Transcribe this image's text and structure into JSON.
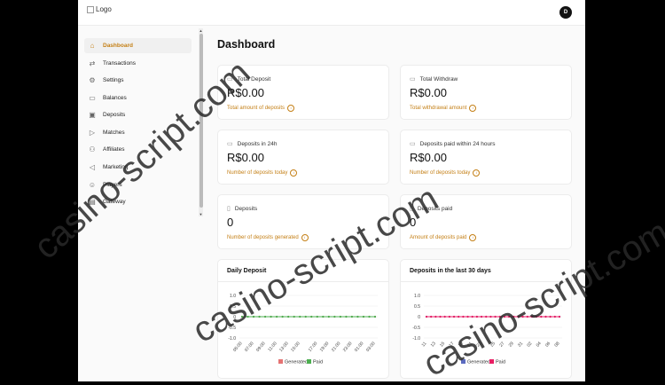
{
  "header": {
    "logo_alt": "Logo",
    "avatar_initial": "D"
  },
  "sidebar": {
    "items": [
      {
        "label": "Dashboard",
        "icon": "home-icon",
        "active": true
      },
      {
        "label": "Transactions",
        "icon": "transfer-icon"
      },
      {
        "label": "Settings",
        "icon": "gear-icon"
      },
      {
        "label": "Balances",
        "icon": "wallet-icon"
      },
      {
        "label": "Deposits",
        "icon": "box-icon"
      },
      {
        "label": "Matches",
        "icon": "play-icon"
      },
      {
        "label": "Affiliates",
        "icon": "users-icon"
      },
      {
        "label": "Marketing",
        "icon": "megaphone-icon"
      },
      {
        "label": "Players",
        "icon": "players-icon"
      },
      {
        "label": "Gateway",
        "icon": "gateway-icon"
      }
    ]
  },
  "page": {
    "title": "Dashboard"
  },
  "cards": [
    {
      "label": "Total Deposit",
      "value": "R$0.00",
      "sub": "Total amount of deposits"
    },
    {
      "label": "Total Withdraw",
      "value": "R$0.00",
      "sub": "Total withdrawal amount"
    },
    {
      "label": "Deposits in 24h",
      "value": "R$0.00",
      "sub": "Number of deposits today"
    },
    {
      "label": "Deposits paid within 24 hours",
      "value": "R$0.00",
      "sub": "Number of deposits today"
    },
    {
      "label": "Deposits",
      "value": "0",
      "sub": "Number of deposits generated"
    },
    {
      "label": "Deposits paid",
      "value": "0",
      "sub": "Amount of deposits paid"
    }
  ],
  "colors": {
    "accent": "#c47f15",
    "generated_daily": "#e57373",
    "paid_daily": "#4caf50",
    "generated_30d": "#5c6bc0",
    "paid_30d": "#e91e63"
  },
  "chart_data": [
    {
      "type": "line",
      "title": "Daily Deposit",
      "categories": [
        "05:00",
        "07:00",
        "09:00",
        "11:00",
        "13:00",
        "15:00",
        "17:00",
        "19:00",
        "21:00",
        "23:00",
        "01:00",
        "03:00"
      ],
      "x_points": 24,
      "series": [
        {
          "name": "Generated",
          "values": [
            0,
            0,
            0,
            0,
            0,
            0,
            0,
            0,
            0,
            0,
            0,
            0,
            0,
            0,
            0,
            0,
            0,
            0,
            0,
            0,
            0,
            0,
            0,
            0
          ]
        },
        {
          "name": "Paid",
          "values": [
            0,
            0,
            0,
            0,
            0,
            0,
            0,
            0,
            0,
            0,
            0,
            0,
            0,
            0,
            0,
            0,
            0,
            0,
            0,
            0,
            0,
            0,
            0,
            0
          ]
        }
      ],
      "yticks": [
        "1.0",
        "0.5",
        "0",
        "-0.5",
        "-1.0"
      ],
      "ylim": [
        -1,
        1
      ],
      "legend": "bottom"
    },
    {
      "type": "line",
      "title": "Deposits in the last 30 days",
      "categories": [
        "11",
        "13",
        "15",
        "17",
        "19",
        "21",
        "23",
        "25",
        "27",
        "29",
        "31",
        "02",
        "04",
        "06",
        "08"
      ],
      "x_points": 30,
      "series": [
        {
          "name": "Generated",
          "values": [
            0,
            0,
            0,
            0,
            0,
            0,
            0,
            0,
            0,
            0,
            0,
            0,
            0,
            0,
            0,
            0,
            0,
            0,
            0,
            0,
            0,
            0,
            0,
            0,
            0,
            0,
            0,
            0,
            0,
            0
          ]
        },
        {
          "name": "Paid",
          "values": [
            0,
            0,
            0,
            0,
            0,
            0,
            0,
            0,
            0,
            0,
            0,
            0,
            0,
            0,
            0,
            0,
            0,
            0,
            0,
            0,
            0,
            0,
            0,
            0,
            0,
            0,
            0,
            0,
            0,
            0
          ]
        }
      ],
      "yticks": [
        "1.0",
        "0.5",
        "0",
        "-0.5",
        "-1.0"
      ],
      "ylim": [
        -1,
        1
      ],
      "legend": "bottom"
    }
  ],
  "watermark": "casino-script.com"
}
